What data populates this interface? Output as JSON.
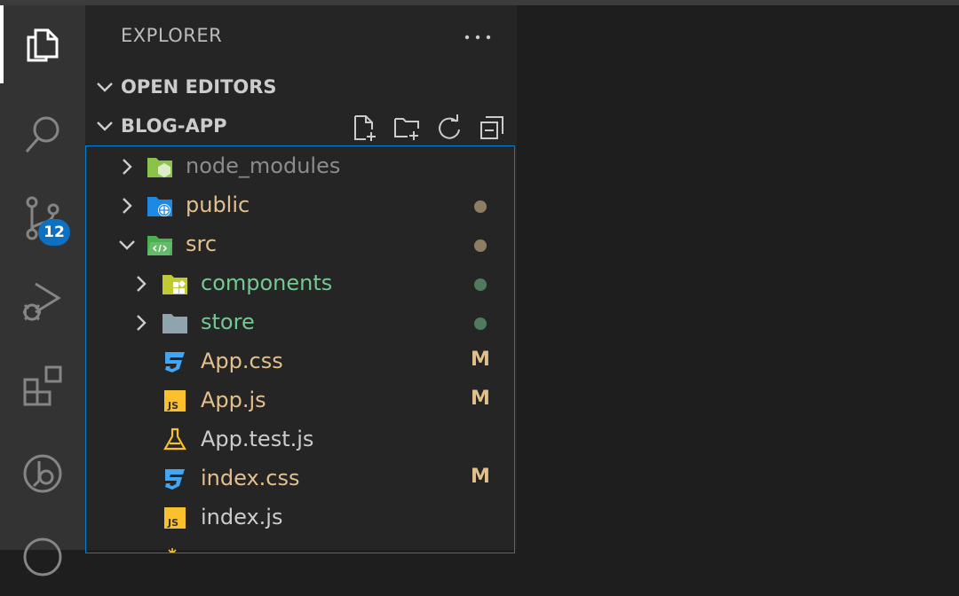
{
  "explorer": {
    "title": "EXPLORER",
    "more_icon": "ellipsis-icon",
    "open_editors_label": "OPEN EDITORS",
    "project_label": "BLOG-APP"
  },
  "activity_bar": {
    "items": [
      {
        "name": "explorer-icon",
        "active": true
      },
      {
        "name": "search-icon"
      },
      {
        "name": "source-control-icon",
        "badge": "12"
      },
      {
        "name": "run-debug-icon"
      },
      {
        "name": "extensions-icon"
      },
      {
        "name": "remote-explorer-icon"
      }
    ]
  },
  "colors": {
    "accent": "#0e70c0",
    "modified": "#e2c08d",
    "untracked": "#73c991",
    "ignored": "#8c8c8c",
    "focus_border": "#007fd4"
  },
  "tree": [
    {
      "name": "node_modules",
      "type": "folder",
      "color": "#8c8c8c"
    },
    {
      "name": "public",
      "type": "folder",
      "color": "#e2c08d",
      "dot": "#8d7d63"
    },
    {
      "name": "src",
      "type": "folder-open",
      "color": "#e2c08d",
      "dot": "#8d7d63"
    },
    {
      "name": "components",
      "type": "folder",
      "color": "#73c991",
      "dot": "#4f7a5e"
    },
    {
      "name": "store",
      "type": "folder",
      "color": "#73c991",
      "dot": "#4f7a5e"
    },
    {
      "name": "App.css",
      "type": "css",
      "color": "#e2c08d",
      "status": "M"
    },
    {
      "name": "App.js",
      "type": "js",
      "color": "#e2c08d",
      "status": "M"
    },
    {
      "name": "App.test.js",
      "type": "test",
      "color": "#cccccc"
    },
    {
      "name": "index.css",
      "type": "css",
      "color": "#e2c08d",
      "status": "M"
    },
    {
      "name": "index.js",
      "type": "js",
      "color": "#cccccc"
    }
  ]
}
